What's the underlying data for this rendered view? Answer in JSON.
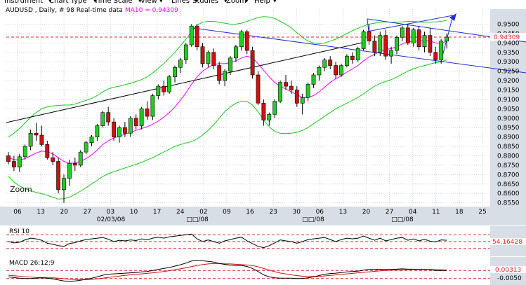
{
  "menu": {
    "items": [
      "Instrument",
      "Chart Type",
      "Time Scale",
      "View",
      "Lines",
      "Studies",
      "Zoom",
      "Help"
    ],
    "arrow_glyph": "▼"
  },
  "colors": {
    "background": "#ffffff",
    "grid": "#c8d2dc",
    "up_candle": "#22cc22",
    "down_candle": "#cc1111",
    "ma": "#ff00ff",
    "bollinger": "#1ac81a",
    "trend_blue": "#1f2fd6",
    "trend_black": "#000000",
    "resistance": "#ee2222",
    "axis_panel": "#d8dee6",
    "rsi_line": "#000000",
    "macd_line": "#000000",
    "signal_line": "#cc1111"
  },
  "chart_data": [
    {
      "type": "candlestick",
      "title": "AUDUSD , Daily, # 98 Real-time data",
      "ma_label": "MA10 = 0.94309",
      "zoom_label": "Zoom",
      "y_range": [
        0.853,
        0.958
      ],
      "y_ticks": [
        "0.9500",
        "0.9450",
        "0.9400",
        "0.9350",
        "0.9300",
        "0.9250",
        "0.9200",
        "0.9150",
        "0.9100",
        "0.9050",
        "0.9000",
        "0.8950",
        "0.8900",
        "0.8850",
        "0.8800",
        "0.8750",
        "0.8700",
        "0.8650",
        "0.8600",
        "0.8550"
      ],
      "current_price_label": "0.94309",
      "x_tick_labels": [
        "06",
        "13",
        "20",
        "27",
        "03",
        "10",
        "17",
        "24",
        "02",
        "09",
        "16",
        "23",
        "30",
        "06",
        "13",
        "20",
        "27",
        "04",
        "11",
        "18",
        "25"
      ],
      "x_month_labels": [
        "02/03/08",
        "□□/08",
        "□□/08",
        "□□/08"
      ],
      "candles": [
        [
          0.88,
          0.882,
          0.8755,
          0.877
        ],
        [
          0.877,
          0.88,
          0.872,
          0.874
        ],
        [
          0.874,
          0.881,
          0.8715,
          0.8795
        ],
        [
          0.8795,
          0.886,
          0.878,
          0.885
        ],
        [
          0.885,
          0.894,
          0.883,
          0.892
        ],
        [
          0.892,
          0.8975,
          0.888,
          0.891
        ],
        [
          0.891,
          0.896,
          0.885,
          0.886
        ],
        [
          0.886,
          0.888,
          0.878,
          0.879
        ],
        [
          0.879,
          0.882,
          0.875,
          0.877
        ],
        [
          0.877,
          0.879,
          0.86,
          0.862
        ],
        [
          0.862,
          0.87,
          0.855,
          0.868
        ],
        [
          0.868,
          0.878,
          0.864,
          0.876
        ],
        [
          0.876,
          0.879,
          0.872,
          0.875
        ],
        [
          0.875,
          0.883,
          0.874,
          0.882
        ],
        [
          0.882,
          0.888,
          0.881,
          0.887
        ],
        [
          0.887,
          0.891,
          0.885,
          0.89
        ],
        [
          0.89,
          0.897,
          0.888,
          0.896
        ],
        [
          0.896,
          0.904,
          0.895,
          0.903
        ],
        [
          0.903,
          0.906,
          0.896,
          0.898
        ],
        [
          0.898,
          0.9,
          0.888,
          0.89
        ],
        [
          0.89,
          0.896,
          0.887,
          0.895
        ],
        [
          0.895,
          0.898,
          0.89,
          0.892
        ],
        [
          0.892,
          0.901,
          0.89,
          0.9
        ],
        [
          0.9,
          0.902,
          0.894,
          0.896
        ],
        [
          0.896,
          0.906,
          0.894,
          0.905
        ],
        [
          0.905,
          0.909,
          0.899,
          0.901
        ],
        [
          0.901,
          0.913,
          0.899,
          0.912
        ],
        [
          0.912,
          0.918,
          0.91,
          0.917
        ],
        [
          0.917,
          0.92,
          0.912,
          0.914
        ],
        [
          0.914,
          0.923,
          0.913,
          0.922
        ],
        [
          0.922,
          0.928,
          0.919,
          0.927
        ],
        [
          0.927,
          0.932,
          0.924,
          0.931
        ],
        [
          0.931,
          0.94,
          0.929,
          0.939
        ],
        [
          0.939,
          0.95,
          0.938,
          0.949
        ],
        [
          0.949,
          0.95,
          0.936,
          0.938
        ],
        [
          0.938,
          0.94,
          0.927,
          0.929
        ],
        [
          0.929,
          0.936,
          0.927,
          0.935
        ],
        [
          0.935,
          0.937,
          0.926,
          0.928
        ],
        [
          0.928,
          0.93,
          0.918,
          0.92
        ],
        [
          0.92,
          0.926,
          0.917,
          0.925
        ],
        [
          0.925,
          0.933,
          0.923,
          0.932
        ],
        [
          0.932,
          0.939,
          0.93,
          0.938
        ],
        [
          0.938,
          0.947,
          0.936,
          0.946
        ],
        [
          0.946,
          0.947,
          0.934,
          0.936
        ],
        [
          0.936,
          0.938,
          0.921,
          0.923
        ],
        [
          0.923,
          0.925,
          0.907,
          0.908
        ],
        [
          0.908,
          0.91,
          0.896,
          0.899
        ],
        [
          0.899,
          0.903,
          0.896,
          0.902
        ],
        [
          0.902,
          0.91,
          0.9,
          0.909
        ],
        [
          0.909,
          0.92,
          0.908,
          0.919
        ],
        [
          0.919,
          0.923,
          0.915,
          0.917
        ],
        [
          0.917,
          0.92,
          0.913,
          0.915
        ],
        [
          0.915,
          0.917,
          0.906,
          0.908
        ],
        [
          0.908,
          0.913,
          0.902,
          0.911
        ],
        [
          0.911,
          0.919,
          0.909,
          0.918
        ],
        [
          0.918,
          0.924,
          0.916,
          0.923
        ],
        [
          0.923,
          0.928,
          0.92,
          0.927
        ],
        [
          0.927,
          0.932,
          0.925,
          0.931
        ],
        [
          0.931,
          0.933,
          0.926,
          0.928
        ],
        [
          0.928,
          0.93,
          0.921,
          0.923
        ],
        [
          0.923,
          0.929,
          0.922,
          0.928
        ],
        [
          0.928,
          0.934,
          0.927,
          0.933
        ],
        [
          0.933,
          0.935,
          0.929,
          0.931
        ],
        [
          0.931,
          0.938,
          0.93,
          0.937
        ],
        [
          0.937,
          0.947,
          0.936,
          0.946
        ],
        [
          0.946,
          0.95,
          0.939,
          0.941
        ],
        [
          0.941,
          0.944,
          0.933,
          0.935
        ],
        [
          0.935,
          0.946,
          0.933,
          0.944
        ],
        [
          0.944,
          0.947,
          0.931,
          0.933
        ],
        [
          0.933,
          0.938,
          0.929,
          0.936
        ],
        [
          0.936,
          0.944,
          0.934,
          0.943
        ],
        [
          0.943,
          0.949,
          0.941,
          0.948
        ],
        [
          0.948,
          0.95,
          0.939,
          0.94
        ],
        [
          0.94,
          0.948,
          0.938,
          0.947
        ],
        [
          0.947,
          0.949,
          0.936,
          0.938
        ],
        [
          0.938,
          0.946,
          0.935,
          0.944
        ],
        [
          0.944,
          0.948,
          0.933,
          0.935
        ],
        [
          0.935,
          0.938,
          0.929,
          0.931
        ],
        [
          0.931,
          0.942,
          0.929,
          0.941
        ],
        [
          0.941,
          0.945,
          0.937,
          0.9431
        ]
      ],
      "ma10": [
        0.879,
        0.878,
        0.8778,
        0.8785,
        0.88,
        0.8815,
        0.8825,
        0.8822,
        0.881,
        0.879,
        0.877,
        0.876,
        0.8762,
        0.877,
        0.8785,
        0.8805,
        0.883,
        0.886,
        0.888,
        0.8895,
        0.8905,
        0.8915,
        0.8925,
        0.8935,
        0.8945,
        0.8955,
        0.8968,
        0.8985,
        0.9005,
        0.903,
        0.906,
        0.9095,
        0.9135,
        0.918,
        0.922,
        0.925,
        0.927,
        0.9285,
        0.929,
        0.929,
        0.9295,
        0.9305,
        0.932,
        0.933,
        0.932,
        0.929,
        0.9255,
        0.922,
        0.919,
        0.917,
        0.9155,
        0.914,
        0.9125,
        0.911,
        0.911,
        0.912,
        0.914,
        0.9165,
        0.919,
        0.921,
        0.9225,
        0.9245,
        0.9262,
        0.928,
        0.9305,
        0.9325,
        0.934,
        0.9355,
        0.9365,
        0.937,
        0.938,
        0.9395,
        0.9405,
        0.941,
        0.941,
        0.9412,
        0.941,
        0.94,
        0.9398,
        0.941
      ],
      "bb_upper": [
        0.89,
        0.892,
        0.8945,
        0.8975,
        0.9005,
        0.903,
        0.905,
        0.906,
        0.9065,
        0.9068,
        0.907,
        0.907,
        0.9075,
        0.9085,
        0.9095,
        0.9105,
        0.912,
        0.914,
        0.9155,
        0.9165,
        0.917,
        0.9178,
        0.9185,
        0.9195,
        0.9205,
        0.922,
        0.924,
        0.9265,
        0.929,
        0.932,
        0.935,
        0.9385,
        0.942,
        0.946,
        0.9495,
        0.951,
        0.9515,
        0.9515,
        0.951,
        0.9505,
        0.95,
        0.95,
        0.9505,
        0.9515,
        0.9525,
        0.9535,
        0.954,
        0.9538,
        0.953,
        0.9515,
        0.95,
        0.948,
        0.9455,
        0.943,
        0.941,
        0.94,
        0.9395,
        0.94,
        0.941,
        0.942,
        0.9435,
        0.945,
        0.9465,
        0.9478,
        0.949,
        0.95,
        0.9505,
        0.951,
        0.9512,
        0.951,
        0.951,
        0.9512,
        0.9515,
        0.9515,
        0.9512,
        0.951,
        0.951,
        0.9512,
        0.9515,
        0.952
      ],
      "bb_lower": [
        0.869,
        0.866,
        0.864,
        0.8625,
        0.8615,
        0.8605,
        0.8598,
        0.859,
        0.858,
        0.857,
        0.8572,
        0.858,
        0.8595,
        0.8612,
        0.863,
        0.865,
        0.867,
        0.869,
        0.8705,
        0.8715,
        0.8725,
        0.8735,
        0.8745,
        0.8755,
        0.8765,
        0.8778,
        0.879,
        0.8805,
        0.882,
        0.8835,
        0.885,
        0.886,
        0.8868,
        0.8875,
        0.889,
        0.891,
        0.8935,
        0.8965,
        0.9,
        0.9035,
        0.906,
        0.908,
        0.909,
        0.909,
        0.907,
        0.9035,
        0.899,
        0.8955,
        0.893,
        0.892,
        0.8918,
        0.892,
        0.8925,
        0.8935,
        0.895,
        0.897,
        0.899,
        0.901,
        0.903,
        0.905,
        0.9065,
        0.908,
        0.9095,
        0.911,
        0.913,
        0.915,
        0.917,
        0.9185,
        0.9195,
        0.9205,
        0.9218,
        0.9235,
        0.925,
        0.9262,
        0.9272,
        0.928,
        0.9288,
        0.9295,
        0.93,
        0.931
      ],
      "resistance_level": 0.9431
    },
    {
      "type": "line",
      "title": "RSI 10",
      "current_value_label": "54.16428",
      "levels": [
        70,
        50,
        30
      ],
      "values": [
        50,
        46,
        48,
        55,
        60,
        58,
        54,
        45,
        42,
        38,
        36,
        44,
        47,
        52,
        56,
        58,
        60,
        62,
        57,
        50,
        54,
        52,
        55,
        53,
        58,
        55,
        60,
        63,
        60,
        64,
        66,
        68,
        70,
        72,
        58,
        50,
        55,
        50,
        45,
        52,
        56,
        60,
        63,
        52,
        44,
        36,
        32,
        38,
        46,
        55,
        52,
        50,
        45,
        50,
        56,
        58,
        60,
        62,
        56,
        50,
        56,
        60,
        58,
        60,
        66,
        60,
        54,
        60,
        52,
        56,
        60,
        62,
        54,
        58,
        52,
        57,
        51,
        49,
        55,
        54
      ]
    },
    {
      "type": "line",
      "title": "MACD 26;12;9",
      "current_value_label": "0.00313",
      "ticks": [
        "-0.0050"
      ],
      "macd": [
        -0.002,
        -0.0024,
        -0.0028,
        -0.003,
        -0.003,
        -0.0028,
        -0.0026,
        -0.0028,
        -0.0032,
        -0.0038,
        -0.0044,
        -0.0046,
        -0.0044,
        -0.004,
        -0.0034,
        -0.0028,
        -0.002,
        -0.001,
        -0.0004,
        -0.0002,
        0.0,
        0.0002,
        0.0004,
        0.0006,
        0.001,
        0.0012,
        0.0018,
        0.0024,
        0.003,
        0.0036,
        0.0044,
        0.0052,
        0.0062,
        0.0074,
        0.0078,
        0.0076,
        0.0072,
        0.0068,
        0.006,
        0.0054,
        0.005,
        0.0048,
        0.0048,
        0.0042,
        0.003,
        0.0012,
        -0.0008,
        -0.002,
        -0.0026,
        -0.0028,
        -0.0028,
        -0.0028,
        -0.003,
        -0.003,
        -0.0026,
        -0.002,
        -0.0012,
        -0.0004,
        0.0,
        0.0002,
        0.0006,
        0.001,
        0.0012,
        0.0014,
        0.002,
        0.0024,
        0.0024,
        0.0026,
        0.0024,
        0.0024,
        0.0026,
        0.0028,
        0.0026,
        0.0026,
        0.0024,
        0.0024,
        0.0022,
        0.0018,
        0.0018,
        0.0018
      ],
      "signal": [
        -0.001,
        -0.0013,
        -0.0016,
        -0.0019,
        -0.0021,
        -0.0023,
        -0.0024,
        -0.0025,
        -0.0026,
        -0.0028,
        -0.0031,
        -0.0034,
        -0.0036,
        -0.0037,
        -0.0036,
        -0.0035,
        -0.0032,
        -0.0028,
        -0.0023,
        -0.0019,
        -0.0015,
        -0.0011,
        -0.0008,
        -0.0005,
        -0.0002,
        0.0001,
        0.0004,
        0.0008,
        0.0012,
        0.0017,
        0.0022,
        0.0028,
        0.0034,
        0.0041,
        0.0048,
        0.0053,
        0.0057,
        0.0059,
        0.0059,
        0.0058,
        0.0057,
        0.0055,
        0.0053,
        0.0051,
        0.0047,
        0.004,
        0.003,
        0.002,
        0.0011,
        0.0003,
        -0.0003,
        -0.0008,
        -0.0012,
        -0.0016,
        -0.0018,
        -0.0018,
        -0.0017,
        -0.0014,
        -0.0011,
        -0.0008,
        -0.0005,
        -0.0002,
        0.0001,
        0.0004,
        0.0007,
        0.001,
        0.0013,
        0.0016,
        0.0018,
        0.002,
        0.0021,
        0.0022,
        0.0023,
        0.0024,
        0.0024,
        0.0024,
        0.0024,
        0.0023,
        0.0022,
        0.0021
      ]
    }
  ]
}
